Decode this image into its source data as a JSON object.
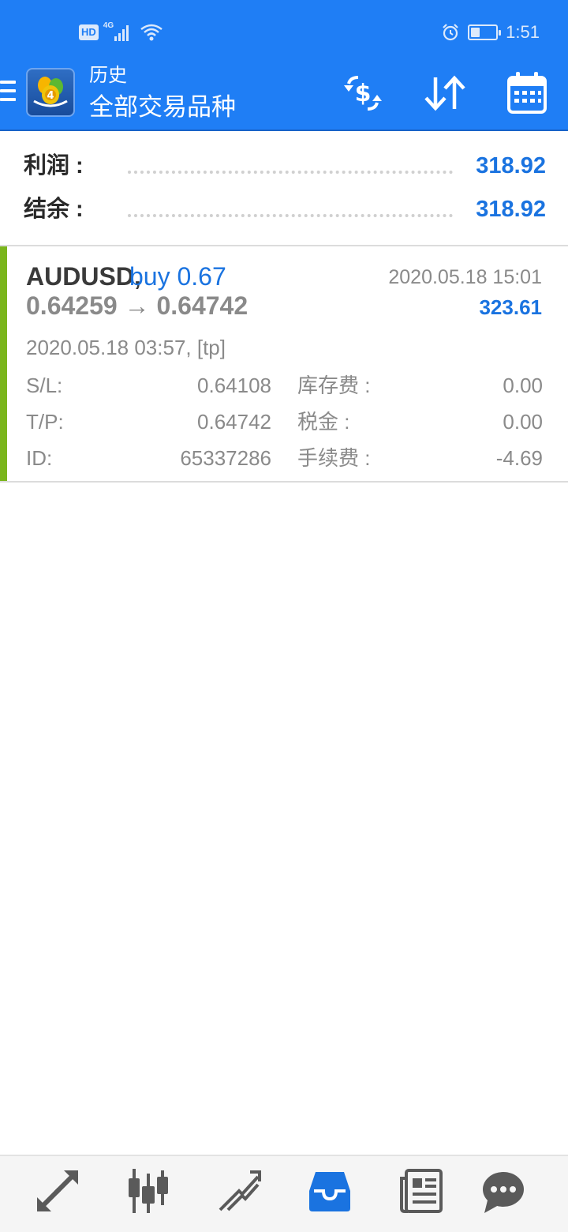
{
  "status_bar": {
    "hd": "HD",
    "network": "4G",
    "time": "1:51",
    "battery_level": 0.35
  },
  "app_bar": {
    "title": "历史",
    "subtitle": "全部交易品种",
    "icons": [
      "menu-icon",
      "app-logo",
      "currency-exchange-icon",
      "sort-icon",
      "calendar-icon"
    ]
  },
  "summary": {
    "profit_label": "利润 :",
    "profit_value": "318.92",
    "balance_label": "结余 :",
    "balance_value": "318.92"
  },
  "deal": {
    "symbol": "AUDUSD,",
    "side": "buy 0.67",
    "close_time": "2020.05.18 15:01",
    "prices": "0.64259 → 0.64742",
    "profit": "323.61",
    "open_info": "2020.05.18 03:57, [tp]",
    "sl_label": "S/L:",
    "sl_value": "0.64108",
    "tp_label": "T/P:",
    "tp_value": "0.64742",
    "id_label": "ID:",
    "id_value": "65337286",
    "swap_label": "库存费 :",
    "swap_value": "0.00",
    "tax_label": "税金 :",
    "tax_value": "0.00",
    "commission_label": "手续费 :",
    "commission_value": "-4.69",
    "indicator_color": "#7ab51d"
  },
  "bottom_nav": {
    "items": [
      "quotes-icon",
      "chart-icon",
      "trade-icon",
      "history-icon",
      "news-icon",
      "chat-icon"
    ],
    "active": "history-icon",
    "active_color": "#1a73e0",
    "inactive_color": "#5a5a5a"
  },
  "colors": {
    "primary": "#1f7ef5",
    "value_blue": "#1a73e0",
    "buy_bar": "#7ab51d"
  }
}
